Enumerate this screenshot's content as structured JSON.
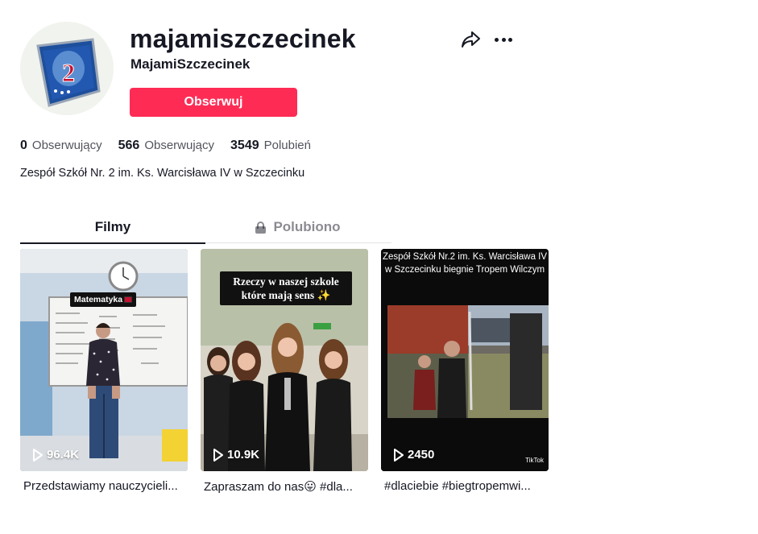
{
  "profile": {
    "username": "majamiszczecinek",
    "nickname": "MajamiSzczecinek",
    "follow_label": "Obserwuj",
    "avatar_badge_number": "2",
    "stats": [
      {
        "num": "0",
        "label": "Obserwujący"
      },
      {
        "num": "566",
        "label": "Obserwujący"
      },
      {
        "num": "3549",
        "label": "Polubień"
      }
    ],
    "bio": "Zespół Szkół Nr. 2 im. Ks. Warcisława IV w Szczecinku"
  },
  "actions": {
    "share_icon": "share-icon",
    "more_icon": "more-icon"
  },
  "tabs": [
    {
      "label": "Filmy",
      "active": true
    },
    {
      "label": "Polubiono",
      "active": false,
      "icon": "lock-icon"
    }
  ],
  "videos": [
    {
      "plays": "96.4K",
      "caption": "Przedstawiamy nauczycieli...",
      "overlay": "Matematyka"
    },
    {
      "plays": "10.9K",
      "caption": "Zapraszam do nas😛 #dla...",
      "overlay": "Rzeczy w naszej szkole które mają sens ✨"
    },
    {
      "plays": "2450",
      "caption": "#dlaciebie #biegtropemwi...",
      "overlay": "Zespół Szkół Nr.2 im. Ks. Warcisława IV w Szczecinku biegnie Tropem Wilczym",
      "watermark": "TikTok"
    }
  ],
  "colors": {
    "accent": "#fe2c55",
    "text": "#161823"
  }
}
